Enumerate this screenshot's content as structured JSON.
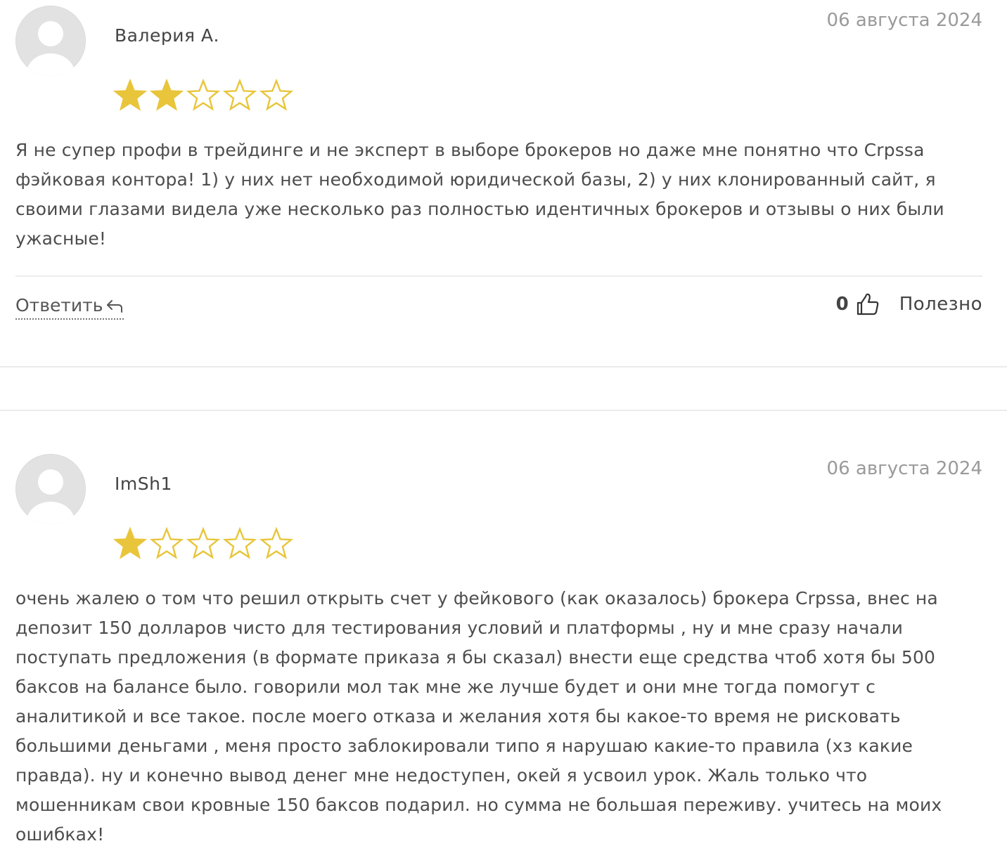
{
  "colors": {
    "star_fill": "#e8c53a",
    "star_outline": "#e8c53a",
    "date_text": "#9a9a9a",
    "body_text": "#4d4d4d",
    "avatar_bg": "#e2e2e2",
    "avatar_fg": "#ffffff"
  },
  "reviews": [
    {
      "author": "Валерия А.",
      "date": "06 августа 2024",
      "rating": 2,
      "rating_max": 5,
      "text": "Я не супер профи в трейдинге и не эксперт в выборе брокеров но даже мне понятно что Crpssa фэйковая контора! 1) у них нет необходимой юридической базы, 2) у них клонированный сайт, я своими глазами видела уже несколько раз полностью идентичных брокеров и отзывы о них были ужасные!",
      "reply_label": "Ответить",
      "reply_icon": "reply-arrow-icon",
      "likes": "0",
      "like_icon": "thumbs-up-icon",
      "helpful_label": "Полезно"
    },
    {
      "author": "ImSh1",
      "date": "06 августа 2024",
      "rating": 1,
      "rating_max": 5,
      "text": "очень жалею о том что решил открыть счет у фейкового (как оказалось) брокера Crpssa, внес на депозит 150 долларов чисто для тестирования условий и платформы , ну и мне сразу начали поступать предложения (в формате приказа я бы сказал) внести еще средства чтоб хотя бы 500 баксов на балансе было. говорили мол так мне же лучше будет и они мне тогда помогут с аналитикой и все такое. после моего отказа и желания хотя бы какое-то время не рисковать большими деньгами , меня просто заблокировали типо я нарушаю какие-то правила (хз какие правда). ну и конечно вывод денег мне недоступен, окей я усвоил урок. Жаль только что мошенникам свои кровные 150 баксов подарил. но сумма не большая переживу. учитесь на моих ошибках!"
    }
  ]
}
